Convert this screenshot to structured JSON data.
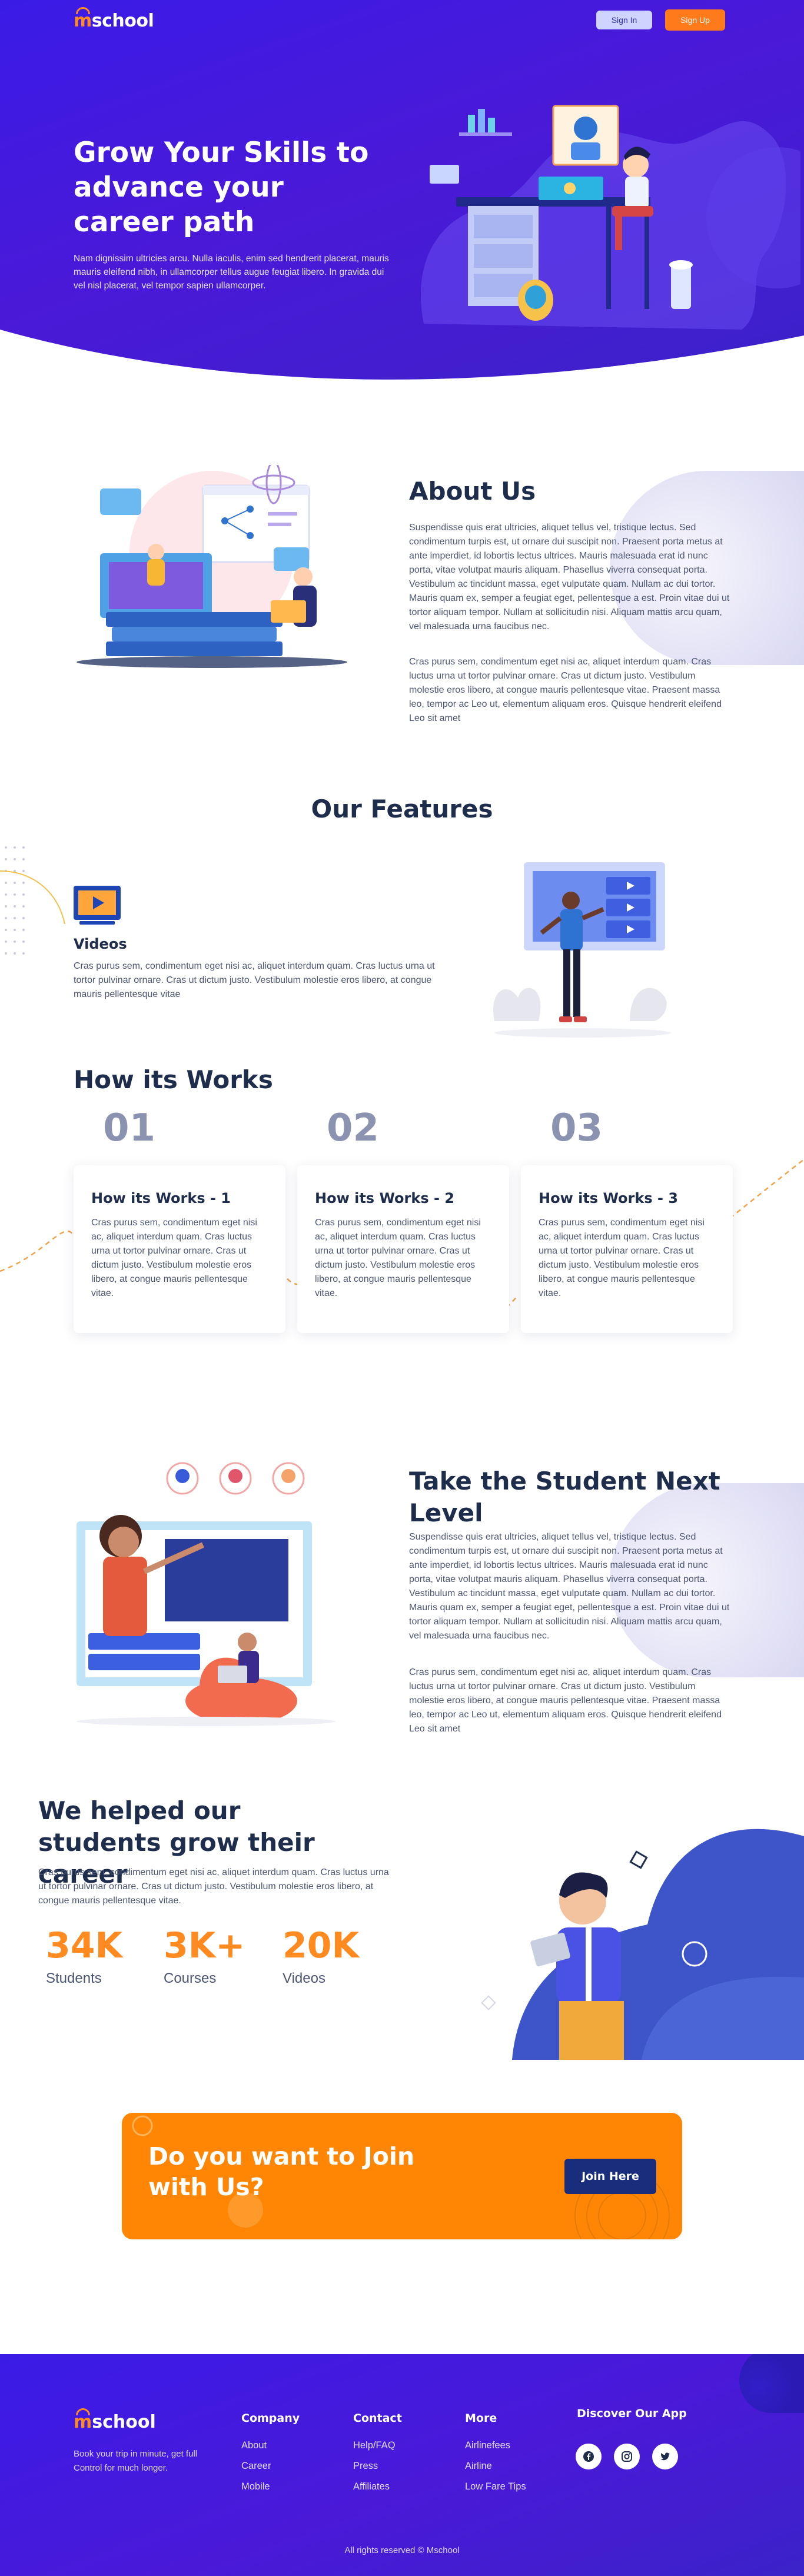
{
  "nav": {
    "logo_m": "m",
    "logo_rest": "school",
    "signin_label": "Sign In",
    "signup_label": "Sign Up"
  },
  "hero": {
    "title": "Grow Your Skills to advance your career path",
    "text": "Nam dignissim ultricies arcu. Nulla iaculis, enim sed hendrerit placerat, mauris mauris eleifend nibh, in ullamcorper tellus augue feugiat libero. In gravida dui vel nisl placerat, vel tempor sapien ullamcorper."
  },
  "about": {
    "title": "About Us",
    "p1": "Suspendisse quis erat ultricies, aliquet tellus vel, tristique lectus. Sed condimentum turpis est, ut ornare dui suscipit non. Praesent porta metus at ante imperdiet, id lobortis lectus ultrices. Mauris malesuada erat id nunc porta, vitae volutpat mauris aliquam. Phasellus viverra consequat porta. Vestibulum ac tincidunt massa, eget vulputate quam. Nullam ac dui tortor. Mauris quam ex, semper a feugiat eget, pellentesque a est. Proin vitae dui ut tortor aliquam tempor. Nullam at sollicitudin nisi. Aliquam mattis arcu quam, vel malesuada urna faucibus nec.",
    "p2": "Cras purus sem, condimentum eget nisi ac, aliquet interdum quam. Cras luctus urna ut tortor pulvinar ornare. Cras ut dictum justo. Vestibulum molestie eros libero, at congue mauris pellentesque vitae. Praesent massa leo, tempor ac Leo ut, elementum aliquam eros. Quisque hendrerit eleifend Leo sit amet"
  },
  "features": {
    "title": "Our Features",
    "item_title": "Videos",
    "item_text": "Cras purus sem, condimentum eget nisi ac, aliquet interdum quam. Cras luctus urna ut tortor pulvinar ornare. Cras ut dictum justo. Vestibulum molestie eros libero, at congue mauris pellentesque vitae"
  },
  "works": {
    "title": "How its Works",
    "steps": [
      {
        "num": "01",
        "title": "How its Works - 1",
        "text": "Cras purus sem, condimentum eget nisi ac, aliquet interdum quam. Cras luctus urna ut tortor pulvinar ornare. Cras ut dictum justo. Vestibulum molestie eros libero, at congue mauris pellentesque vitae."
      },
      {
        "num": "02",
        "title": "How its Works - 2",
        "text": "Cras purus sem, condimentum eget nisi ac, aliquet interdum quam. Cras luctus urna ut tortor pulvinar ornare. Cras ut dictum justo. Vestibulum molestie eros libero, at congue mauris pellentesque vitae."
      },
      {
        "num": "03",
        "title": "How its Works - 3",
        "text": "Cras purus sem, condimentum eget nisi ac, aliquet interdum quam. Cras luctus urna ut tortor pulvinar ornare. Cras ut dictum justo. Vestibulum molestie eros libero, at congue mauris pellentesque vitae."
      }
    ]
  },
  "next": {
    "title": "Take the Student Next Level",
    "p1": "Suspendisse quis erat ultricies, aliquet tellus vel, tristique lectus. Sed condimentum turpis est, ut ornare dui suscipit non. Praesent porta metus at ante imperdiet, id lobortis lectus ultrices. Mauris malesuada erat id nunc porta, vitae volutpat mauris aliquam. Phasellus viverra consequat porta. Vestibulum ac tincidunt massa, eget vulputate quam. Nullam ac dui tortor. Mauris quam ex, semper a feugiat eget, pellentesque a est. Proin vitae dui ut tortor aliquam tempor. Nullam at sollicitudin nisi. Aliquam mattis arcu quam, vel malesuada urna faucibus nec.",
    "p2": "Cras purus sem, condimentum eget nisi ac, aliquet interdum quam. Cras luctus urna ut tortor pulvinar ornare. Cras ut dictum justo. Vestibulum molestie eros libero, at congue mauris pellentesque vitae. Praesent massa leo, tempor ac Leo ut, elementum aliquam eros. Quisque hendrerit eleifend Leo sit amet"
  },
  "stats": {
    "title": "We helped our students grow their career",
    "text": "Cras purus sem, condimentum eget nisi ac, aliquet interdum quam. Cras luctus urna ut tortor pulvinar ornare. Cras ut dictum justo. Vestibulum molestie eros libero, at congue mauris pellentesque vitae.",
    "items": [
      {
        "value": "34K",
        "label": "Students"
      },
      {
        "value": "3K+",
        "label": "Courses"
      },
      {
        "value": "20K",
        "label": "Videos"
      }
    ]
  },
  "join": {
    "title": "Do you want to Join with Us?",
    "button": "Join Here"
  },
  "footer": {
    "logo_m": "m",
    "logo_rest": "school",
    "tagline": "Book your trip in minute, get full Control for much longer.",
    "company": {
      "title": "Company",
      "links": [
        "About",
        "Career",
        "Mobile"
      ]
    },
    "contact": {
      "title": "Contact",
      "links": [
        "Help/FAQ",
        "Press",
        "Affiliates"
      ]
    },
    "more": {
      "title": "More",
      "links": [
        "Airlinefees",
        "Airline",
        "Low Fare Tips"
      ]
    },
    "app_title": "Discover Our App",
    "social": [
      "facebook-icon",
      "instagram-icon",
      "twitter-icon"
    ],
    "copyright": "All rights reserved © Mschool"
  },
  "colors": {
    "primary": "#3a1be6",
    "accent": "#ff8605",
    "heading": "#1f2d4d",
    "join_button": "#1a2d7d"
  }
}
